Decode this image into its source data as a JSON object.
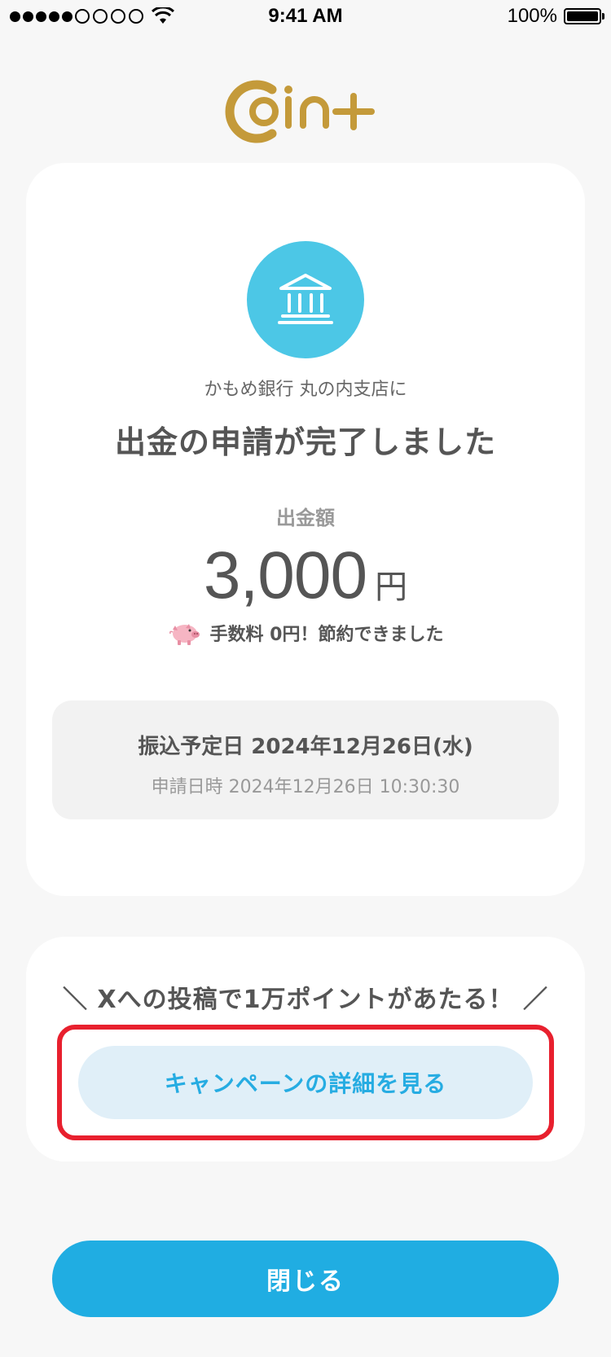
{
  "status_bar": {
    "time": "9:41 AM",
    "battery": "100%"
  },
  "brand": {
    "logo_text": "coin+",
    "logo_color": "#c49a3a"
  },
  "completion": {
    "bank_icon": "bank-icon",
    "bank_line": "かもめ銀行 丸の内支店に",
    "title": "出金の申請が完了しました",
    "amount_label": "出金額",
    "amount": "3,000",
    "amount_unit": "円",
    "fee_text": "手数料 0円！節約できました",
    "transfer_date": "振込予定日 2024年12月26日(水)",
    "apply_date": "申請日時 2024年12月26日 10:30:30"
  },
  "campaign": {
    "headline": "＼ Xへの投稿で1万ポイントがあたる！ ／",
    "button_label": "キャンペーンの詳細を見る"
  },
  "footer": {
    "close_label": "閉じる"
  },
  "colors": {
    "accent": "#20ade2",
    "icon_circle": "#4cc7e6",
    "highlight": "#e8202e",
    "campaign_button_bg": "#e0eff8"
  }
}
